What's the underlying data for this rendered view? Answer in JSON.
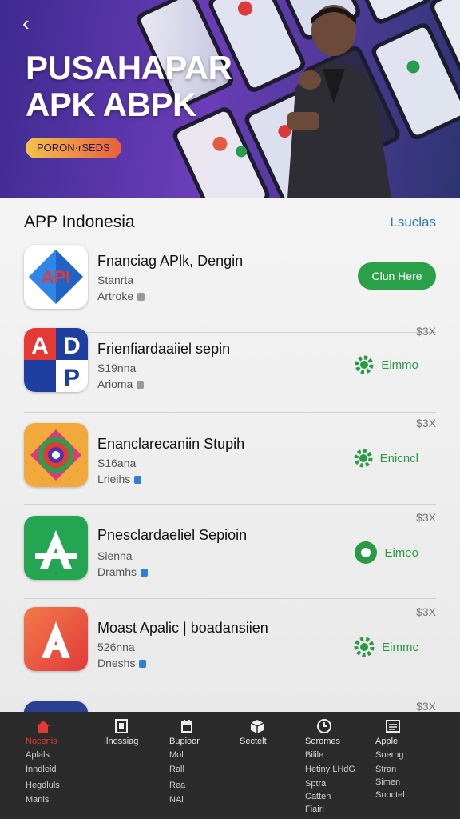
{
  "hero": {
    "back_glyph": "‹",
    "title_line1": "PUSAHAPAR",
    "title_line2": "APK ABPK",
    "pill": "PORON·rSEDS"
  },
  "section": {
    "title": "APP Indonesia",
    "link": "Lsuclas"
  },
  "apps": [
    {
      "name": "Fnanciag APlk, Dengin",
      "sub1": "Stanrta",
      "sub2": "Artroke",
      "price": "",
      "action": "Clun Here",
      "icon_text": "API"
    },
    {
      "name": "Frienfiardaaiiel sepin",
      "sub1": "S19nna",
      "sub2": "Arioma",
      "price": "$3X",
      "action": "Eimmo",
      "icon_text": "ADP"
    },
    {
      "name": "Enanclarecaniin Stupih",
      "sub1": "S16ana",
      "sub2": "Lrieihs",
      "price": "$3X",
      "action": "Enicncl",
      "icon_text": ""
    },
    {
      "name": "Pnesclardaeliel Sepioin",
      "sub1": "Sienna",
      "sub2": "Dramhs",
      "price": "$3X",
      "action": "Eimeo",
      "icon_text": "A"
    },
    {
      "name": "Moast Apalic | boadansiien",
      "sub1": "526nna",
      "sub2": "Dneshs",
      "price": "$3X",
      "action": "Eimmc",
      "icon_text": "A"
    },
    {
      "name": "",
      "sub1": "",
      "sub2": "",
      "price": "$3X",
      "action": "",
      "icon_text": ""
    }
  ],
  "tabs": [
    {
      "label": "Nocenis",
      "subs": [
        "Aplals",
        "Inndleid",
        "Hegdluls",
        "Manis"
      ]
    },
    {
      "label": "Ilnossiag",
      "subs": []
    },
    {
      "label": "Bupioor",
      "subs": [
        "Mol",
        "Rall",
        "Rea",
        "NAi"
      ]
    },
    {
      "label": "Sectelt",
      "subs": []
    },
    {
      "label": "Soromes",
      "subs": [
        "Bilile",
        "Hetiny LHdG",
        "Sptral",
        "Catten",
        "Fiairl"
      ]
    },
    {
      "label": "Apple",
      "subs": [
        "Soerng",
        "Stran",
        "Simen",
        "Snoctel"
      ]
    }
  ],
  "colors": {
    "accent_green": "#2aa148",
    "tab_active": "#e53935",
    "link_blue": "#2a7ab8"
  }
}
